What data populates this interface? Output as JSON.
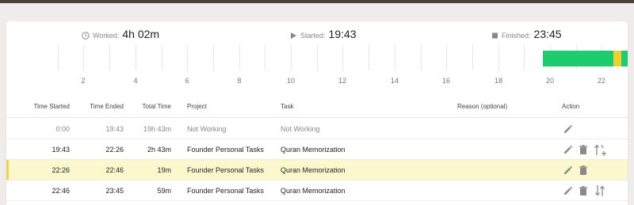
{
  "summary": {
    "worked": {
      "label": "Worked:",
      "value": "4h 02m",
      "icon": "clock-icon"
    },
    "started": {
      "label": "Started:",
      "value": "19:43",
      "icon": "play-icon"
    },
    "finished": {
      "label": "Finished:",
      "value": "23:45",
      "icon": "stop-icon"
    }
  },
  "timeline": {
    "hour_ticks": [
      "2",
      "4",
      "6",
      "8",
      "10",
      "12",
      "14",
      "16",
      "18",
      "20",
      "22"
    ],
    "range_hours": [
      0,
      24
    ],
    "segments": [
      {
        "start": "19:43",
        "end": "22:26",
        "color": "#1ccc6e"
      },
      {
        "start": "22:26",
        "end": "22:46",
        "color": "#eed12f"
      },
      {
        "start": "22:46",
        "end": "23:45",
        "color": "#1ccc6e"
      }
    ]
  },
  "table": {
    "headers": {
      "time_started": "Time Started",
      "time_ended": "Time Ended",
      "total_time": "Total Time",
      "project": "Project",
      "task": "Task",
      "reason": "Reason (optional)",
      "action": "Action"
    },
    "rows": [
      {
        "start": "0:00",
        "end": "19:43",
        "total": "19h 43m",
        "project": "Not Working",
        "task": "Not Working",
        "muted": true,
        "highlight": false,
        "actions": [
          "edit"
        ]
      },
      {
        "start": "19:43",
        "end": "22:26",
        "total": "2h 43m",
        "project": "Founder Personal Tasks",
        "task": "Quran Memorization",
        "muted": false,
        "highlight": false,
        "actions": [
          "edit",
          "delete",
          "split-up"
        ]
      },
      {
        "start": "22:26",
        "end": "22:46",
        "total": "19m",
        "project": "Founder Personal Tasks",
        "task": "Quran Memorization",
        "muted": false,
        "highlight": true,
        "actions": [
          "edit",
          "delete"
        ]
      },
      {
        "start": "22:46",
        "end": "23:45",
        "total": "59m",
        "project": "Founder Personal Tasks",
        "task": "Quran Memorization",
        "muted": false,
        "highlight": false,
        "actions": [
          "edit",
          "delete",
          "split-down"
        ]
      }
    ]
  },
  "colors": {
    "working": "#1ccc6e",
    "selected": "#eed12f",
    "highlight_row": "#fdf7cd",
    "icon": "#8a8a8a"
  }
}
